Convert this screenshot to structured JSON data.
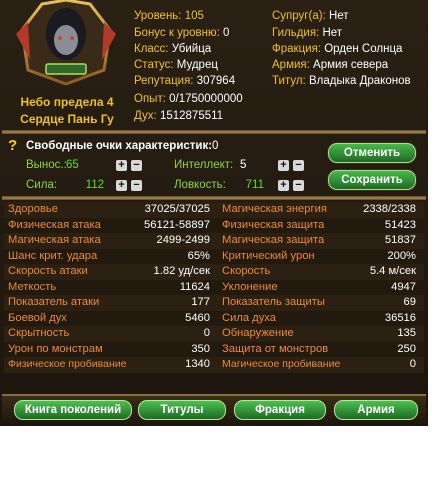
{
  "profile": {
    "rank_line1": "Небо предела 4",
    "rank_line2": "Сердце Пань Гу"
  },
  "info_left": [
    {
      "label": "Уровень:",
      "value": "105"
    },
    {
      "label": "Бонус к уровню:",
      "value": "0"
    },
    {
      "label": "Класс:",
      "value": "Убийца"
    },
    {
      "label": "Статус:",
      "value": "Мудрец"
    },
    {
      "label": "Репутация:",
      "value": "307964"
    },
    {
      "label": "Опыт:",
      "value": "0/1750000000"
    },
    {
      "label": "Дух:",
      "value": "1512875511"
    }
  ],
  "info_right": [
    {
      "label": "Супруг(а):",
      "value": "Нет"
    },
    {
      "label": "Гильдия:",
      "value": "Нет"
    },
    {
      "label": "Фракция:",
      "value": "Орден Солнца"
    },
    {
      "label": "Армия:",
      "value": "Армия севера"
    },
    {
      "label": "Титул:",
      "value": "Владыка Драконов"
    }
  ],
  "points": {
    "title": "Свободные очки характеристик:",
    "value": "0",
    "attrs": [
      {
        "label": "Вынос.:",
        "value": "65"
      },
      {
        "label": "Интеллект:",
        "value": "5"
      },
      {
        "label": "Сила:",
        "value": "112"
      },
      {
        "label": "Ловкость:",
        "value": "711"
      }
    ],
    "plus": "+",
    "minus": "−",
    "cancel_label": "Отменить",
    "save_label": "Сохранить"
  },
  "stats": [
    [
      "Здоровье",
      "37025/37025",
      "Магическая энергия",
      "2338/2338"
    ],
    [
      "Физическая атака",
      "56121-58897",
      "Физическая защита",
      "51423"
    ],
    [
      "Магическая атака",
      "2499-2499",
      "Магическая защита",
      "51837"
    ],
    [
      "Шанс крит. удара",
      "65%",
      "Критический урон",
      "200%"
    ],
    [
      "Скорость атаки",
      "1.82 уд/сек",
      "Скорость",
      "5.4 м/сек"
    ],
    [
      "Меткость",
      "11624",
      "Уклонение",
      "4947"
    ],
    [
      "Показатель атаки",
      "177",
      "Показатель защиты",
      "69"
    ],
    [
      "Боевой дух",
      "5460",
      "Сила духа",
      "36516"
    ],
    [
      "Скрытность",
      "0",
      "Обнаружение",
      "135"
    ],
    [
      "Урон по монстрам",
      "350",
      "Защита от монстров",
      "250"
    ],
    [
      "Физическое пробивание",
      "1340",
      "Магическое пробивание",
      "0"
    ]
  ],
  "buttons": [
    "Книга поколений",
    "Титулы",
    "Фракция",
    "Армия"
  ],
  "colors": {
    "panel_bg": "#231a10",
    "label_orange": "#ed8a3a",
    "gold": "#f0c030",
    "green": "#5fe02a",
    "button_green": "#2f8f35"
  }
}
